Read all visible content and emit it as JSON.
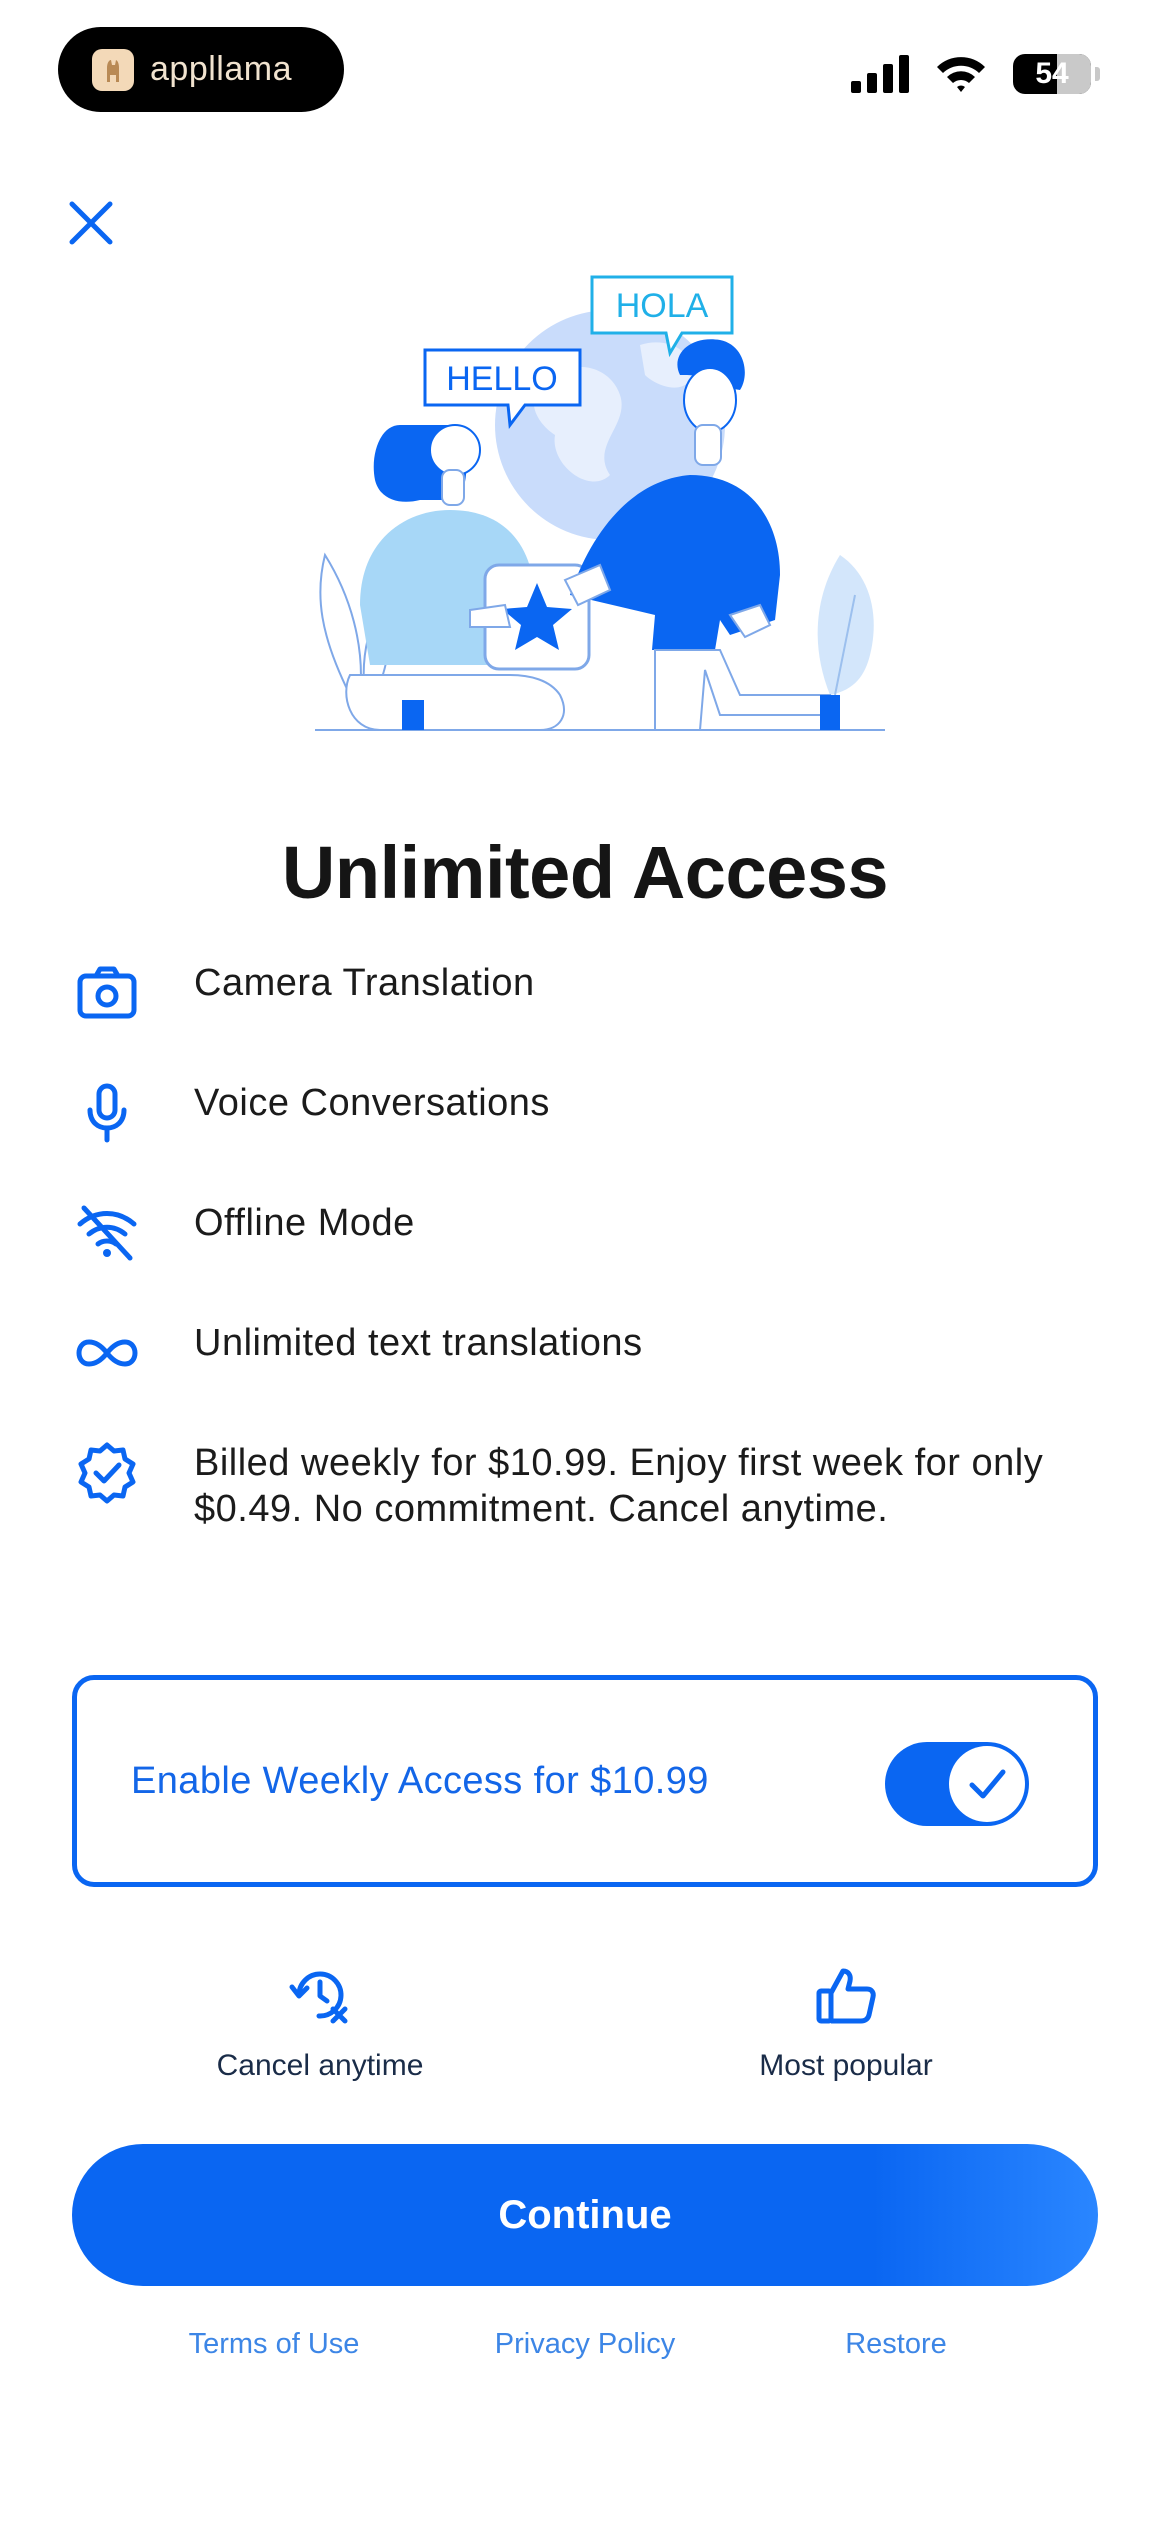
{
  "status_bar": {
    "app_badge": "appllama",
    "battery": "54",
    "icons": [
      "signal-icon",
      "wifi-icon",
      "battery-icon"
    ]
  },
  "close_icon": "close-icon",
  "illustration": {
    "speech_left": "HELLO",
    "speech_right": "HOLA"
  },
  "title": "Unlimited Access",
  "features": [
    {
      "icon": "camera-icon",
      "text": "Camera Translation"
    },
    {
      "icon": "microphone-icon",
      "text": "Voice Conversations"
    },
    {
      "icon": "wifi-off-icon",
      "text": "Offline Mode"
    },
    {
      "icon": "infinity-icon",
      "text": "Unlimited text translations"
    },
    {
      "icon": "verified-badge-icon",
      "text": "Billed weekly for $10.99. Enjoy first week for only $0.49. No commitment. Cancel anytime."
    }
  ],
  "toggle": {
    "label": "Enable Weekly Access for $10.99",
    "enabled": true
  },
  "badges": [
    {
      "icon": "history-cancel-icon",
      "label": "Cancel anytime"
    },
    {
      "icon": "thumbs-up-icon",
      "label": "Most popular"
    }
  ],
  "cta": {
    "label": "Continue"
  },
  "footer_links": [
    "Terms of Use",
    "Privacy Policy",
    "Restore"
  ],
  "colors": {
    "accent": "#0a66f2",
    "link": "#3d86e6",
    "title": "#151515"
  }
}
